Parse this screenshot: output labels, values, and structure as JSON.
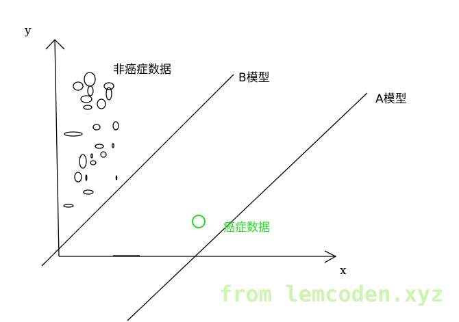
{
  "axes": {
    "x_label": "x",
    "y_label": "y"
  },
  "labels": {
    "non_cancer": "非癌症数据",
    "cancer": "癌症数据",
    "model_b": "B模型",
    "model_a": "A模型"
  },
  "watermark": "from lemcoden.xyz",
  "colors": {
    "ink": "#000000",
    "cancer_green": "#22dd22",
    "watermark_green": "#ccf5b0"
  }
}
